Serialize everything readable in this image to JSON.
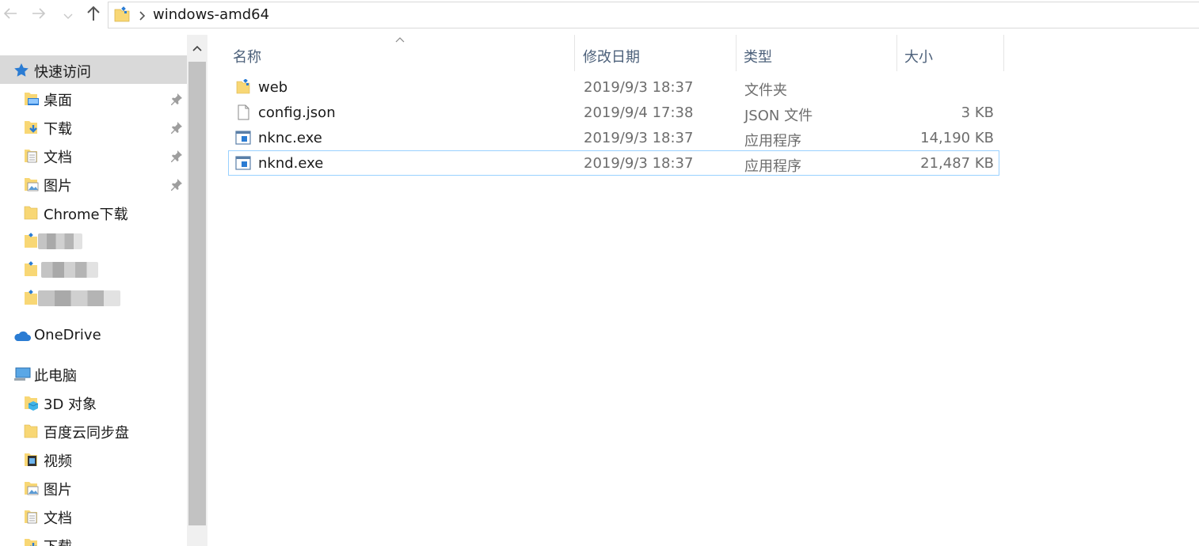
{
  "address_bar": {
    "path": "windows-amd64"
  },
  "sidebar": {
    "quick_access": {
      "label": "快速访问",
      "items": [
        {
          "label": "桌面",
          "pinned": true,
          "icon": "desktop-folder-icon"
        },
        {
          "label": "下载",
          "pinned": true,
          "icon": "downloads-folder-icon"
        },
        {
          "label": "文档",
          "pinned": true,
          "icon": "documents-folder-icon"
        },
        {
          "label": "图片",
          "pinned": true,
          "icon": "pictures-folder-icon"
        },
        {
          "label": "Chrome下载",
          "pinned": false,
          "icon": "folder-icon"
        }
      ]
    },
    "onedrive": {
      "label": "OneDrive"
    },
    "this_pc": {
      "label": "此电脑",
      "items": [
        {
          "label": "3D 对象",
          "icon": "3d-objects-folder-icon"
        },
        {
          "label": "百度云同步盘",
          "icon": "folder-icon"
        },
        {
          "label": "视频",
          "icon": "videos-folder-icon"
        },
        {
          "label": "图片",
          "icon": "pictures-folder-icon"
        },
        {
          "label": "文档",
          "icon": "documents-folder-icon"
        },
        {
          "label": "下载",
          "icon": "downloads-folder-icon"
        }
      ]
    }
  },
  "columns": {
    "name": "名称",
    "date": "修改日期",
    "type": "类型",
    "size": "大小"
  },
  "files": [
    {
      "name": "web",
      "date": "2019/9/3 18:37",
      "type": "文件夹",
      "size": "",
      "icon": "folder-icon"
    },
    {
      "name": "config.json",
      "date": "2019/9/4 17:38",
      "type": "JSON 文件",
      "size": "3 KB",
      "icon": "document-icon"
    },
    {
      "name": "nknc.exe",
      "date": "2019/9/3 18:37",
      "type": "应用程序",
      "size": "14,190 KB",
      "icon": "application-icon"
    },
    {
      "name": "nknd.exe",
      "date": "2019/9/3 18:37",
      "type": "应用程序",
      "size": "21,487 KB",
      "icon": "application-icon"
    }
  ],
  "colors": {
    "selected_nav": "#d9d9d9",
    "focus_border": "#99d1ff",
    "header_text": "#4c607a",
    "folder_yellow": "#f8d775",
    "accent_blue": "#2b7cd3"
  }
}
